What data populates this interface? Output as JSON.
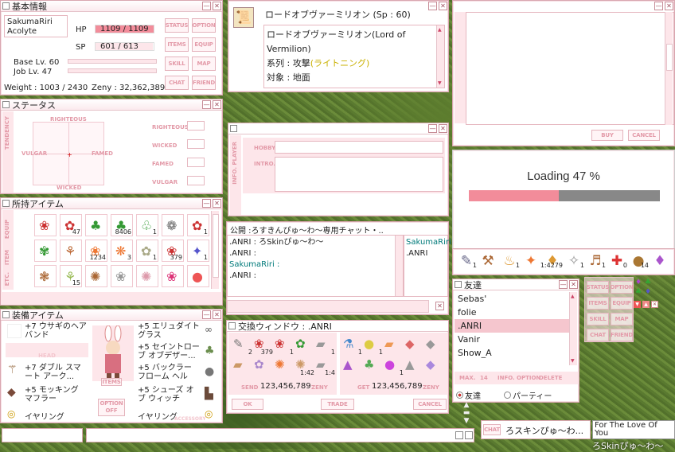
{
  "basic": {
    "title": "基本情報",
    "name": "SakumaRiri",
    "job": "Acolyte",
    "hp_label": "HP",
    "hp": "1109 / 1109",
    "hp_frac": 1.0,
    "sp_label": "SP",
    "sp": "601 / 613",
    "sp_frac": 0.98,
    "base": "Base Lv. 60",
    "jobl": "Job Lv. 47",
    "weight": "Weight : 1003 / 2430",
    "zeny": "Zeny : 32,362,389",
    "btns": [
      "STATUS",
      "OPTION",
      "ITEMS",
      "EQUIP",
      "SKILL",
      "MAP",
      "CHAT",
      "FRIEND"
    ]
  },
  "status": {
    "title": "ステータス",
    "north": "RIGHTEOUS",
    "south": "WICKED",
    "west": "VULGAR",
    "east": "FAMED",
    "side": "TENDENCY",
    "rows": [
      "RIGHTEOUS",
      "WICKED",
      "FAMED",
      "VULGAR"
    ]
  },
  "items": {
    "title": "所持アイテム",
    "tabs": [
      "ITEM",
      "EQUIP",
      "ETC."
    ],
    "row1": [
      "",
      "47",
      "",
      "8406",
      "1",
      "",
      "1"
    ],
    "row2": [
      "",
      "",
      "1234",
      "3",
      "1",
      "379",
      "1"
    ],
    "row3": [
      "",
      "15",
      "",
      "",
      "",
      "",
      ""
    ]
  },
  "equip": {
    "title": "装備アイテム",
    "left": [
      "+7 ウサギのヘアバンド",
      "HEAD",
      "+7 ダブル スマート アーク...",
      "+5 モッキング マフラー",
      "イヤリング"
    ],
    "right": [
      "+5 エリュダイト グラス",
      "+5 セイントローブ オブデザー...",
      "+5 バックラー フローム ヘル",
      "+5 シューズ オブ ウィッチ",
      "イヤリング"
    ],
    "items_btn": "ITEMS",
    "opt": "OPTION OFF",
    "acc": "ACCESSORY"
  },
  "skill": {
    "title": "ロードオブヴァーミリオン (Sp : 60)",
    "lines": [
      "ロードオブヴァーミリオン(Lord of",
      "Vermilion)",
      "系列 : 攻撃",
      "(ライトニング)",
      "対象 : 地面"
    ]
  },
  "info": {
    "side": "INFO. PLAYER",
    "hobby": "HOBBY",
    "intro": "INTRO."
  },
  "chat": {
    "title": "公開 :ろすきんぴゅ〜わ〜専用チャット・..",
    "lines": [
      ".ANRI : ろSkinぴゅ〜わ〜",
      ".ANRI :",
      "SakumaRiri :",
      ".ANRI :"
    ],
    "members": [
      "SakumaRiri",
      ".ANRI"
    ]
  },
  "trade": {
    "title": "交換ウィンドウ : .ANRI",
    "left_n": [
      "2",
      "379",
      "1",
      "",
      "1",
      "",
      "",
      "",
      "1:42",
      "1:4"
    ],
    "right_n": [
      "1",
      "1",
      "",
      "",
      "",
      "",
      "",
      "1",
      "",
      ""
    ],
    "send": "SEND",
    "zeny1": "123,456,789",
    "zeny": "ZENY",
    "get": "GET",
    "zeny2": "123,456,789",
    "ok": "OK",
    "trade": "TRADE",
    "cancel": "CANCEL"
  },
  "shop": {
    "buy": "BUY",
    "cancel": "CANCEL"
  },
  "loading": {
    "text": "Loading 47 %",
    "frac": 0.47
  },
  "hotbar": {
    "n": [
      "1",
      "",
      "1",
      "",
      "1:4279",
      "1",
      "1",
      "0",
      "14",
      ""
    ]
  },
  "friends": {
    "title": "友達",
    "list": [
      "Sebas'",
      "folie",
      ".ANRI",
      "Vanir",
      "Show_A"
    ],
    "max": "MAX.",
    "count": "14",
    "info": "INFO.",
    "opt": "OPTION",
    "del": "DELETE",
    "r1": "友達",
    "r2": "パーティー"
  },
  "mini": [
    "STATUS",
    "OPTION",
    "ITEMS",
    "EQUIP",
    "SKILL",
    "MAP",
    "CHAT",
    "FRIEND"
  ],
  "bottom": {
    "chat_tag": "CHAT",
    "bubble": "ろスキンぴゅ〜わ...",
    "sign": "For The Love Of You",
    "float": "ろSkinぴゅ〜わ〜"
  }
}
